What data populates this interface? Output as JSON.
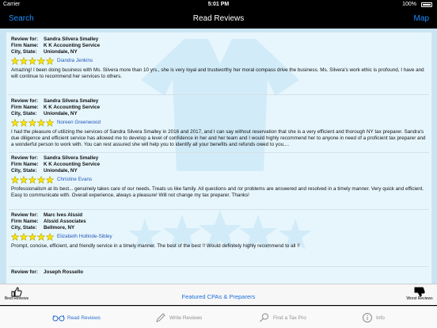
{
  "status_bar": {
    "carrier": "Carrier",
    "time": "5:01 PM",
    "battery": "100%"
  },
  "nav_bar": {
    "left_button": "Search",
    "title": "Read Reviews",
    "right_button": "Map"
  },
  "labels": {
    "review_for": "Review for:",
    "firm_name": "Firm Name:",
    "city_state": "City, State:"
  },
  "reviews": [
    {
      "review_for": "Sandra Silvera Smalley",
      "firm_name": "K K Accounting Service",
      "city_state": "Uniondale, NY",
      "rating": 5,
      "reviewer": "Diandra Jenkins",
      "text": "Amazing! I been doing business with Ms. Silvera more than 10 yrs., she is very loyal and trustworthy her moral compass drive the business. Ms. Silvera's work ethic is profound, I have and will continue to recommend her services to others."
    },
    {
      "review_for": "Sandra Silvera Smalley",
      "firm_name": "K K Accounting Service",
      "city_state": "Uniondale, NY",
      "rating": 5,
      "reviewer": "Noreen Greenwood",
      "text": "I had the pleasure of utilizing the services of Sandra Silvera Smalley in 2016 and 2017, and I can say without reservation that she is a very efficient and thorough NY tax preparer. Sandra's due diligence and efficient service has allowed me to develop a level of confidence in her and her team and I would highly recommend her to anyone in need of a proficient tax preparer and a wonderful person to work with. You can rest assured she will help you to identify all your benefits and refunds owed to you...."
    },
    {
      "review_for": "Sandra Silvera Smalley",
      "firm_name": "K K Accounting Service",
      "city_state": "Uniondale, NY",
      "rating": 5,
      "reviewer": "Christine Evans",
      "text": "Professionalism at its best... genuinely takes care of our needs. Treats us like family. All questions and /or problems are answered and resolved in a timely manner. Very quick and efficient. Easy to communicate with. Overall experience, always a pleasure! Will not change my tax preparer. Thanks!"
    },
    {
      "review_for": "Marc Ives Alssid",
      "firm_name": "Alssid Associates",
      "city_state": "Bellmore, NY",
      "rating": 5,
      "reviewer": "Elizabeth Hollinde-Sibley",
      "text": "Prompt, concise, efficient, and friendly service in a timely manner. The best of the best !!   Would definitely highly recommend to all !!"
    },
    {
      "review_for": "Joseph Rossello",
      "firm_name": "",
      "city_state": "",
      "rating": 0,
      "reviewer": "",
      "text": ""
    }
  ],
  "action_bar": {
    "best_reviews": "Best Reviews",
    "featured": "Featured CPAs & Preparers",
    "worst_reviews": "Worst Reviews"
  },
  "tab_bar": {
    "tabs": [
      {
        "label": "Read Reviews",
        "icon": "glasses-icon",
        "active": true
      },
      {
        "label": "Write Reviews",
        "icon": "pencil-icon",
        "active": false
      },
      {
        "label": "Find a Tax Pro",
        "icon": "magnifier-icon",
        "active": false
      },
      {
        "label": "Info",
        "icon": "info-icon",
        "active": false
      }
    ]
  },
  "colors": {
    "accent": "#1e90ff",
    "star": "#ffe600",
    "reviewer_link": "#2457b7",
    "tab_active": "#2b6fd1"
  }
}
